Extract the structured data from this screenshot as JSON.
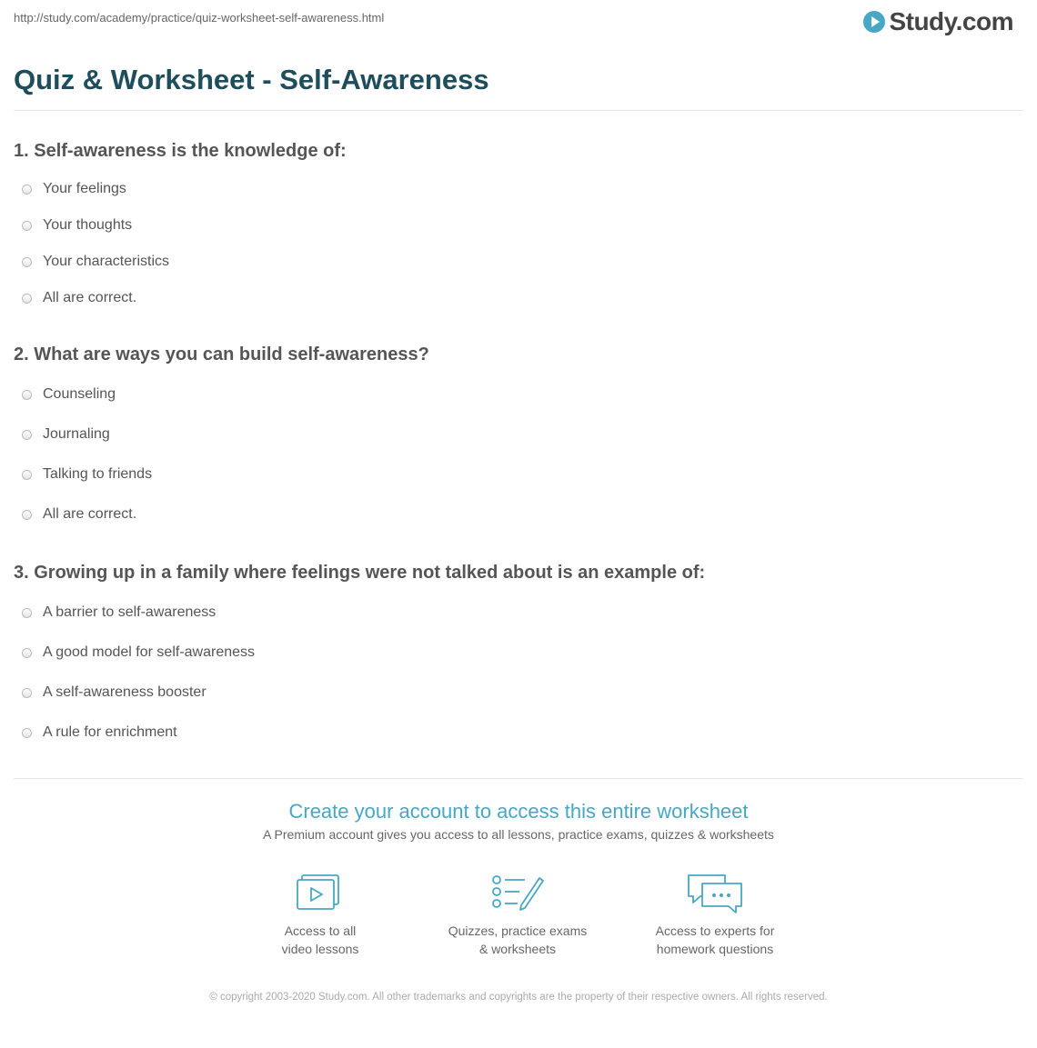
{
  "url": "http://study.com/academy/practice/quiz-worksheet-self-awareness.html",
  "logo": {
    "text": "Study.com",
    "icon": "play-circle-icon",
    "color": "#47a7c5"
  },
  "title": "Quiz & Worksheet - Self-Awareness",
  "questions": [
    {
      "text": "1. Self-awareness is the knowledge of:",
      "options": [
        "Your feelings",
        "Your thoughts",
        "Your characteristics",
        "All are correct."
      ]
    },
    {
      "text": "2. What are ways you can build self-awareness?",
      "options": [
        "Counseling",
        "Journaling",
        "Talking to friends",
        "All are correct."
      ]
    },
    {
      "text": "3. Growing up in a family where feelings were not talked about is an example of:",
      "options": [
        "A barrier to self-awareness",
        "A good model for self-awareness",
        "A self-awareness booster",
        "A rule for enrichment"
      ]
    }
  ],
  "cta": {
    "title": "Create your account to access this entire worksheet",
    "subtitle": "A Premium account gives you access to all lessons, practice exams, quizzes & worksheets"
  },
  "features": [
    {
      "icon": "video-lessons-icon",
      "line1": "Access to all",
      "line2": "video lessons"
    },
    {
      "icon": "quiz-checklist-icon",
      "line1": "Quizzes, practice exams",
      "line2": "& worksheets"
    },
    {
      "icon": "chat-bubbles-icon",
      "line1": "Access to experts for",
      "line2": "homework questions"
    }
  ],
  "copyright": "© copyright 2003-2020 Study.com. All other trademarks and copyrights are the property of their respective owners. All rights reserved.",
  "colors": {
    "title": "#1e4d5c",
    "accent": "#47a7c5",
    "text": "#555555"
  }
}
